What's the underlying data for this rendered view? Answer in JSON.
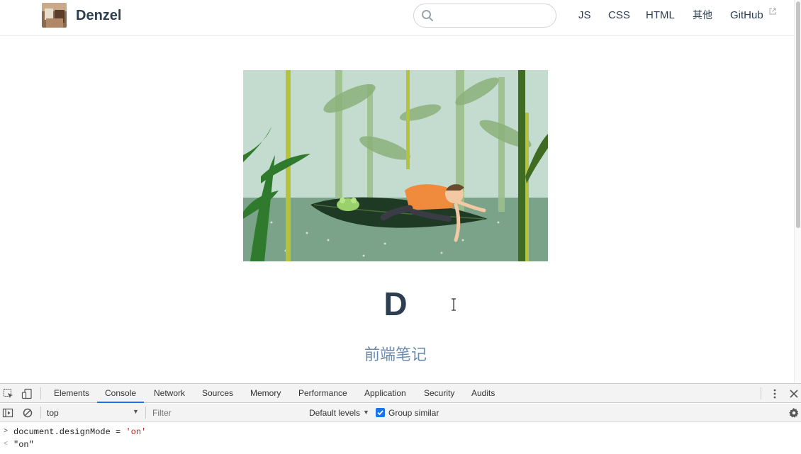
{
  "site": {
    "name": "Denzel",
    "logo_icon": "avatar-photo"
  },
  "search": {
    "value": "",
    "placeholder": ""
  },
  "nav": {
    "links": [
      "JS",
      "CSS",
      "HTML",
      "其他",
      "GitHub"
    ],
    "external_icon": "external-link-icon"
  },
  "hero": {
    "image_alt": "illustration-boy-on-leaf-in-forest",
    "title": "D",
    "description": "前端笔记"
  },
  "devtools": {
    "tabs": [
      "Elements",
      "Console",
      "Network",
      "Sources",
      "Memory",
      "Performance",
      "Application",
      "Security",
      "Audits"
    ],
    "active_tab": "Console",
    "context": "top",
    "filter_placeholder": "Filter",
    "levels": "Default levels",
    "group_similar": "Group similar",
    "group_similar_checked": true,
    "console": {
      "input_code": "document.designMode = ",
      "input_string": "'on'",
      "output": "\"on\""
    }
  },
  "colors": {
    "text": "#2c3e50",
    "accent": "#6a8bad",
    "devtools_blue": "#1a73e8",
    "string_red": "#c41a16"
  }
}
